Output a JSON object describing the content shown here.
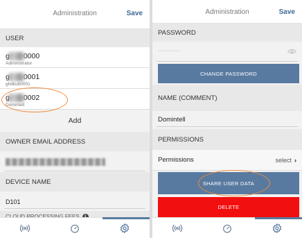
{
  "left": {
    "header": {
      "title": "Administration",
      "save_label": "Save"
    },
    "user_section": "USER",
    "users": [
      {
        "name": "g0000",
        "name_suffix": "0000",
        "role": "Administrator"
      },
      {
        "name": "g0001",
        "name_suffix": "0001",
        "role": "ghdkub0001"
      },
      {
        "name": "g0002",
        "name_suffix": "0002",
        "role": "Domintell"
      }
    ],
    "add_label": "Add",
    "owner_email_label": "OWNER EMAIL ADDRESS",
    "device_name_label": "DEVICE NAME",
    "device_name_value": "D101",
    "partial_label": "CLOUD PROCESSING FEES"
  },
  "right": {
    "header": {
      "title": "Administration",
      "save_label": "Save"
    },
    "password_label": "PASSWORD",
    "password_value": "··········",
    "change_password_label": "CHANGE PASSWORD",
    "name_comment_label": "NAME (COMMENT)",
    "name_comment_value": "Domintell",
    "permissions_section": "PERMISSIONS",
    "permissions_label": "Permissions",
    "permissions_select": "select",
    "share_label": "SHARE USER DATA",
    "delete_label": "DELETE"
  },
  "colors": {
    "accent": "#597aa0",
    "delete": "#f20f0f",
    "highlight": "#f08a3a"
  },
  "nav_icons": [
    "radio-waves-icon",
    "gauge-icon",
    "gear-icon"
  ]
}
